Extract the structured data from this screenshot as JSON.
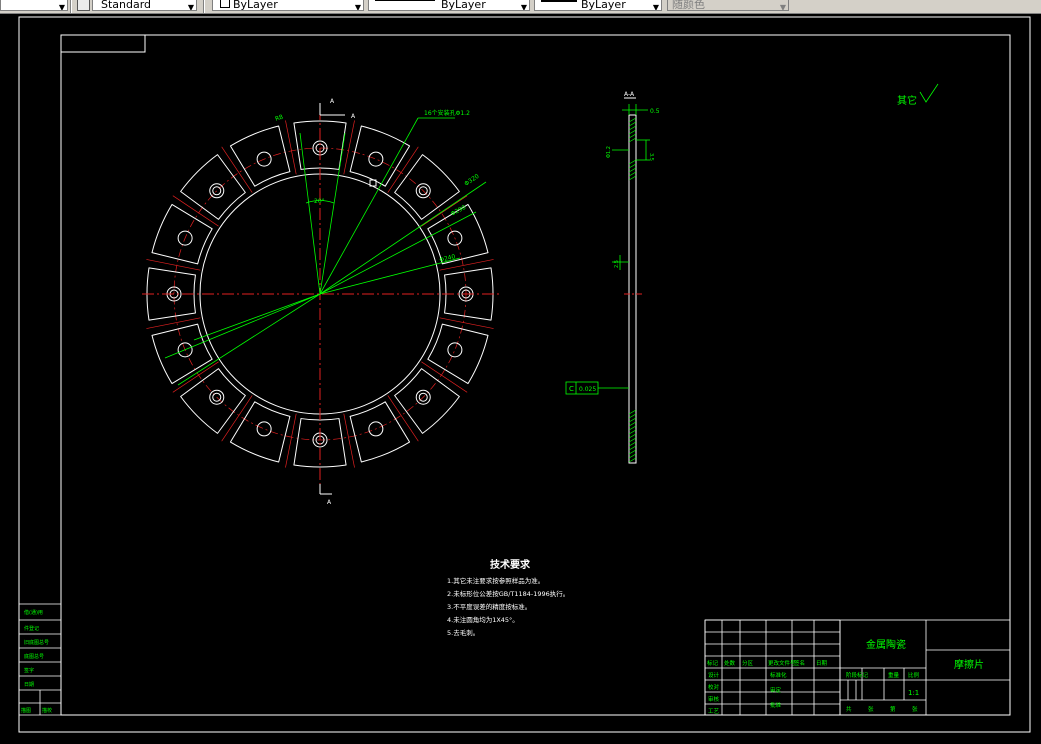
{
  "toolbar": {
    "text_style": "Standard",
    "color": "ByLayer",
    "linetype": "ByLayer",
    "lineweight": "ByLayer",
    "plot_style": "随颜色"
  },
  "drawing": {
    "dim_section_top": "A",
    "dim_section_bottom": "A",
    "dim_holes": "16个安装孔Φ1.2",
    "dim_angle": "20°",
    "dim_dia_outer": "Φ320",
    "dim_dia_mid": "Φ290",
    "dim_dia_inner": "Φ240",
    "dim_r": "R8",
    "section_label": "A-A",
    "dim_thickness": "0.5",
    "dim_groove_h": "3.5",
    "dim_groove_left": "Φ1.2",
    "dim_side": "2.5",
    "tolerance_symbol": "C",
    "tolerance_value": "0.025",
    "roughness_label": "其它",
    "tech_title": "技术要求",
    "tech_notes": [
      "1.其它未注要求按参照样品为准。",
      "2.未标形位公差按GB/T1184-1996执行。",
      "3.不平度误差的精度按标准。",
      "4.未注圆角均为1X45°。",
      "5.去毛刺。"
    ]
  },
  "title_block": {
    "company": "金属陶瓷",
    "part_name": "摩擦片",
    "scale": "1:1",
    "headers": [
      "标记",
      "处数",
      "分区",
      "更改文件号",
      "签名",
      "日期"
    ],
    "row_labels": [
      "设计",
      "校对",
      "审核",
      "工艺"
    ],
    "mid_labels": [
      "标准化",
      "审定",
      "批准"
    ],
    "stage_mark": "阶段标记",
    "weight": "重量",
    "ratio": "比例",
    "sheets": [
      "共",
      "张",
      "第",
      "张"
    ]
  },
  "side_stamp": {
    "labels": [
      "借(通)用",
      "件登记",
      "旧底图总号",
      "底图总号",
      "签字",
      "日期",
      "描图",
      "描校"
    ]
  }
}
